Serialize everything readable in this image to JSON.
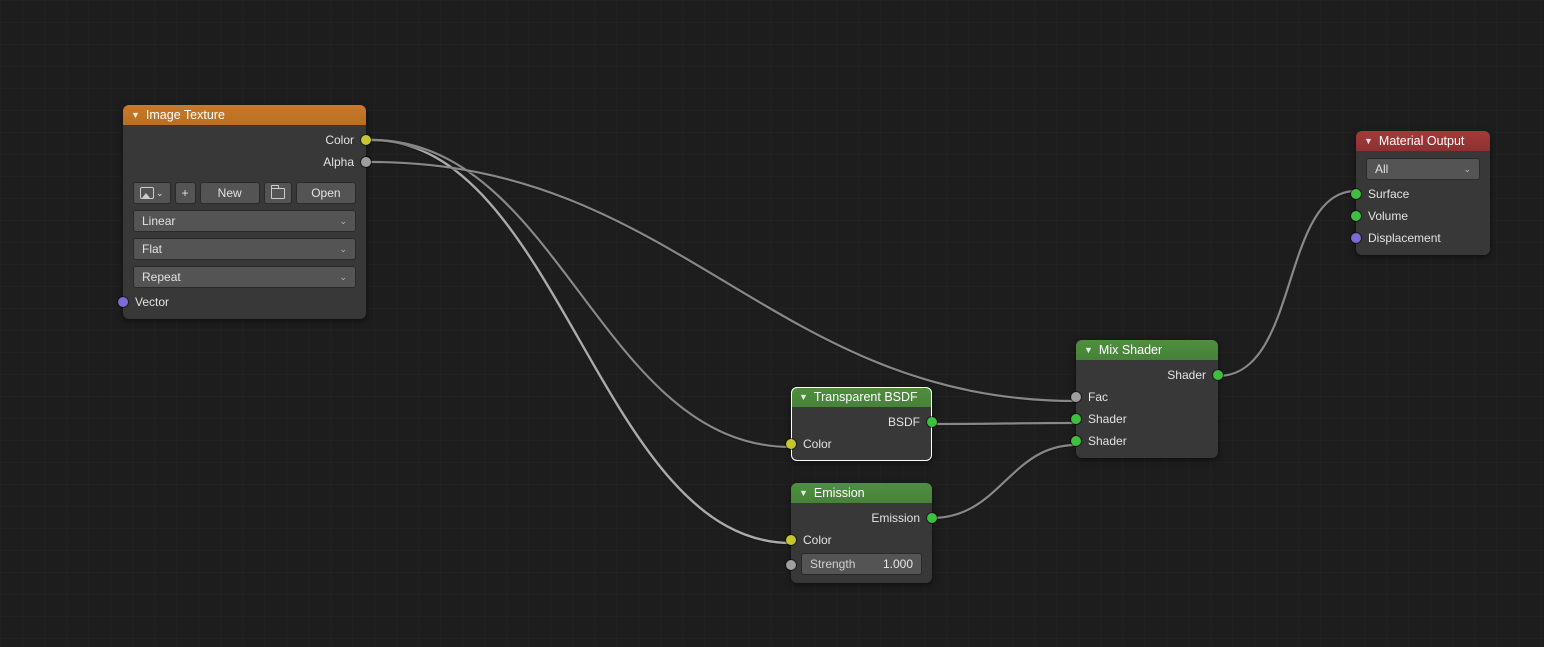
{
  "nodes": {
    "imageTexture": {
      "title": "Image Texture",
      "outputs": {
        "color": "Color",
        "alpha": "Alpha"
      },
      "buttons": {
        "new": "New",
        "open": "Open"
      },
      "interpolation": "Linear",
      "projection": "Flat",
      "extension": "Repeat",
      "inputs": {
        "vector": "Vector"
      }
    },
    "transparent": {
      "title": "Transparent BSDF",
      "outputs": {
        "bsdf": "BSDF"
      },
      "inputs": {
        "color": "Color"
      }
    },
    "emission": {
      "title": "Emission",
      "outputs": {
        "emission": "Emission"
      },
      "inputs": {
        "color": "Color",
        "strength_label": "Strength",
        "strength_value": "1.000"
      }
    },
    "mixShader": {
      "title": "Mix Shader",
      "outputs": {
        "shader": "Shader"
      },
      "inputs": {
        "fac": "Fac",
        "shader1": "Shader",
        "shader2": "Shader"
      }
    },
    "materialOutput": {
      "title": "Material Output",
      "target": "All",
      "inputs": {
        "surface": "Surface",
        "volume": "Volume",
        "displacement": "Displacement"
      }
    }
  }
}
